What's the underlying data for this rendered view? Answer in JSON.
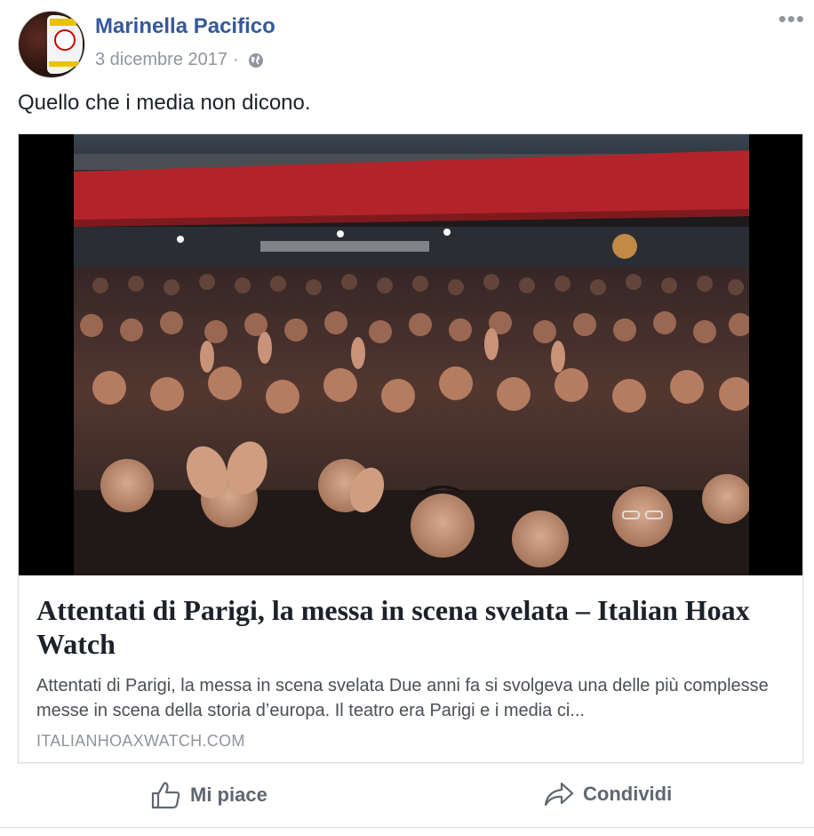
{
  "post": {
    "author": "Marinella Pacifico",
    "date": "3 dicembre 2017",
    "separator": "·",
    "more_label": "•••",
    "text": "Quello che i media non dicono.",
    "icons": {
      "privacy": "globe-icon",
      "more": "more-options-icon"
    }
  },
  "avatar_badge": {
    "top_text": "CAMBIA",
    "bottom_text": "PACIFICO"
  },
  "link_card": {
    "title": "Attentati di Parigi, la messa in scena svelata – Italian Hoax Watch",
    "description": "Attentati di Parigi, la messa in scena svelata Due anni fa si svolgeva una delle più complesse messe in scena della storia d’europa. Il teatro era Parigi e i media ci...",
    "domain": "ITALIANHOAXWATCH.COM"
  },
  "actions": {
    "like_label": "Mi piace",
    "share_label": "Condividi",
    "like_icon": "thumbs-up-icon",
    "share_icon": "share-arrow-icon"
  },
  "colors": {
    "author_link": "#365899",
    "meta_text": "#90949c",
    "action_text": "#606770",
    "balcony_red": "#b3242a"
  }
}
